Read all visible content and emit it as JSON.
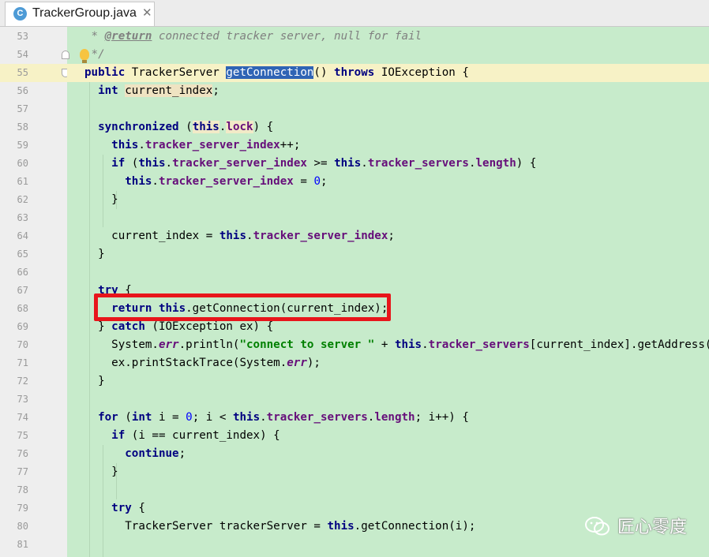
{
  "tab": {
    "title": "TrackerGroup.java",
    "icon_letter": "C"
  },
  "lines": [
    {
      "n": "53",
      "html": " * <span class=\"doc-tag\">@return</span><span class=\"cmt\"> connected tracker server, null for fail</span>"
    },
    {
      "n": "54",
      "html": " <span class=\"cmt\">*/</span>"
    },
    {
      "n": "55",
      "html": "public TrackerServer <span class=\"sel\">getConnection</span>() throws IOException {"
    },
    {
      "n": "56",
      "html": "  <span class=\"kw\">int</span> <span class=\"ident-hl\">current_index</span>;"
    },
    {
      "n": "57",
      "html": ""
    },
    {
      "n": "58",
      "html": "  <span class=\"kw\">synchronized</span> (<span class=\"kw ref-hl\">this</span>.<span class=\"fld ref-hl\">lock</span>) {"
    },
    {
      "n": "59",
      "html": "    <span class=\"kw\">this</span>.<span class=\"fld\">tracker_server_index</span>++;"
    },
    {
      "n": "60",
      "html": "    <span class=\"kw\">if</span> (<span class=\"kw\">this</span>.<span class=\"fld\">tracker_server_index</span> &gt;= <span class=\"kw\">this</span>.<span class=\"fld\">tracker_servers</span>.<span class=\"fld\">length</span>) {"
    },
    {
      "n": "61",
      "html": "      <span class=\"kw\">this</span>.<span class=\"fld\">tracker_server_index</span> = <span class=\"num\">0</span>;"
    },
    {
      "n": "62",
      "html": "    }"
    },
    {
      "n": "63",
      "html": ""
    },
    {
      "n": "64",
      "html": "    current_index = <span class=\"kw\">this</span>.<span class=\"fld\">tracker_server_index</span>;"
    },
    {
      "n": "65",
      "html": "  }"
    },
    {
      "n": "66",
      "html": ""
    },
    {
      "n": "67",
      "html": "  <span class=\"kw\">try</span> {"
    },
    {
      "n": "68",
      "html": "    <span class=\"kw\">return</span> <span class=\"kw\">this</span>.getConnection(current_index);"
    },
    {
      "n": "69",
      "html": "  } <span class=\"kw\">catch</span> (IOException ex) {"
    },
    {
      "n": "70",
      "html": "    System.<span class=\"fld-i\">err</span>.println(<span class=\"str\">\"connect to server \"</span> + <span class=\"kw\">this</span>.<span class=\"fld\">tracker_servers</span>[current_index].getAddress()"
    },
    {
      "n": "71",
      "html": "    ex.printStackTrace(System.<span class=\"fld-i\">err</span>);"
    },
    {
      "n": "72",
      "html": "  }"
    },
    {
      "n": "73",
      "html": ""
    },
    {
      "n": "74",
      "html": "  <span class=\"kw\">for</span> (<span class=\"kw\">int</span> i = <span class=\"num\">0</span>; i &lt; <span class=\"kw\">this</span>.<span class=\"fld\">tracker_servers</span>.<span class=\"fld\">length</span>; i++) {"
    },
    {
      "n": "75",
      "html": "    <span class=\"kw\">if</span> (i == current_index) {"
    },
    {
      "n": "76",
      "html": "      <span class=\"kw\">continue</span>;"
    },
    {
      "n": "77",
      "html": "    }"
    },
    {
      "n": "78",
      "html": ""
    },
    {
      "n": "79",
      "html": "    <span class=\"kw\">try</span> {"
    },
    {
      "n": "80",
      "html": "      TrackerServer trackerServer = <span class=\"kw\">this</span>.getConnection(i);"
    },
    {
      "n": "81",
      "html": ""
    }
  ],
  "watermark": {
    "text": "匠心零度"
  }
}
